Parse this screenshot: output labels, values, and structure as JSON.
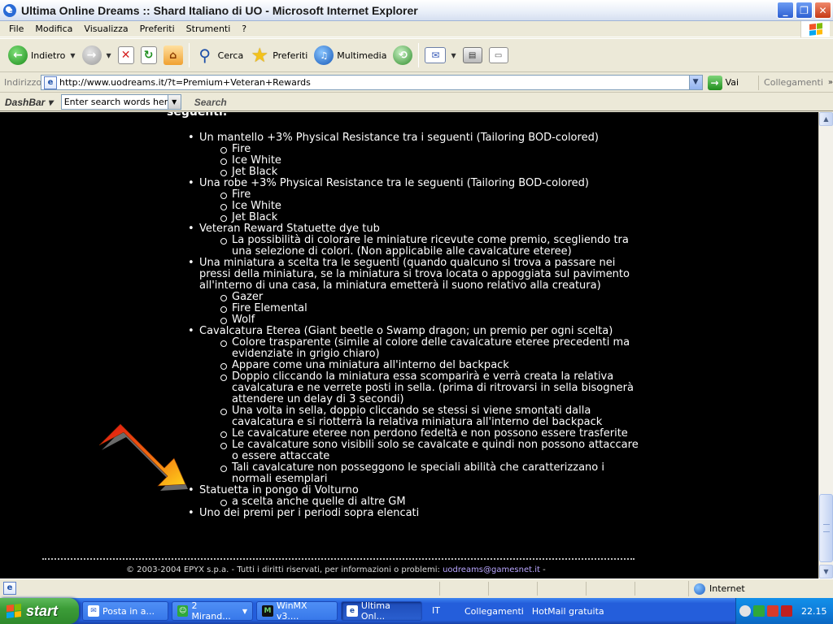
{
  "window": {
    "title": "Ultima Online Dreams :: Shard Italiano di UO - Microsoft Internet Explorer"
  },
  "menu": [
    "File",
    "Modifica",
    "Visualizza",
    "Preferiti",
    "Strumenti",
    "?"
  ],
  "toolbar": {
    "back_label": "Indietro",
    "search_label": "Cerca",
    "favorites_label": "Preferiti",
    "media_label": "Multimedia"
  },
  "address": {
    "label": "Indirizzo",
    "url": "http://www.uodreams.it/?t=Premium+Veteran+Rewards",
    "go_label": "Vai",
    "links_label": "Collegamenti"
  },
  "dashbar": {
    "logo": "DashBar",
    "search_value": "Enter search words here",
    "search_button": "Search"
  },
  "page": {
    "heading_partial": "seguenti:",
    "items": [
      {
        "text": "Un mantello +3% Physical Resistance tra i seguenti (Tailoring BOD-colored)",
        "sub": [
          "Fire",
          "Ice White",
          "Jet Black"
        ]
      },
      {
        "text": "Una robe +3% Physical Resistance tra le seguenti (Tailoring BOD-colored)",
        "sub": [
          "Fire",
          "Ice White",
          "Jet Black"
        ]
      },
      {
        "text": "Veteran Reward Statuette dye tub",
        "sub": [
          "La possibilità di colorare le miniature ricevute come premio, scegliendo tra una selezione di colori. (Non applicabile alle cavalcature eteree)"
        ]
      },
      {
        "text": "Una miniatura a scelta tra le seguenti (quando qualcuno si trova a passare nei pressi della miniatura, se la miniatura si trova locata o appoggiata sul pavimento all'interno di una casa, la miniatura emetterà il suono relativo alla creatura)",
        "sub": [
          "Gazer",
          "Fire Elemental",
          "Wolf"
        ]
      },
      {
        "text": "Cavalcatura Eterea (Giant beetle o Swamp dragon; un premio per ogni scelta)",
        "sub": [
          "Colore trasparente (simile al colore delle cavalcature eteree precedenti ma evidenziate in grigio chiaro)",
          "Appare come una miniatura all'interno del backpack",
          "Doppio cliccando la miniatura essa scomparirà e verrà creata la relativa cavalcatura e ne verrete posti in sella. (prima di ritrovarsi in sella bisognerà attendere un delay di 3 secondi)",
          "Una volta in sella, doppio cliccando se stessi si viene smontati dalla cavalcatura e si riotterrà la relativa miniatura all'interno del backpack",
          "Le cavalcature eteree non perdono fedeltà e non possono essere trasferite",
          "Le cavalcature sono visibili solo se cavalcate e quindi non possono attaccare o essere attaccate",
          "Tali cavalcature non posseggono le speciali abilità che caratterizzano i normali esemplari"
        ]
      },
      {
        "text": "Statuetta in pongo di Volturno",
        "sub": [
          "a scelta anche quelle di altre GM"
        ]
      },
      {
        "text": "Uno dei premi per i periodi sopra elencati",
        "sub": []
      }
    ],
    "footer_text": "© 2003-2004 EPYX s.p.a. - Tutti i diritti riservati, per informazioni o problemi:",
    "footer_email": "uodreams@gamesnet.it",
    "footer_tail": "-"
  },
  "status": {
    "zone": "Internet"
  },
  "taskbar": {
    "start_label": "start",
    "tasks": [
      {
        "label": "Posta in a...",
        "icon": "outlook-icon"
      },
      {
        "label": "2 Mirand...",
        "icon": "messenger-icon"
      },
      {
        "label": "WinMX v3....",
        "icon": "winmx-icon"
      },
      {
        "label": "Ultima Onl...",
        "icon": "ie-icon"
      }
    ],
    "lang": "IT",
    "quicklinks": [
      "Collegamenti",
      "HotMail gratuita"
    ],
    "clock": "22.15"
  }
}
